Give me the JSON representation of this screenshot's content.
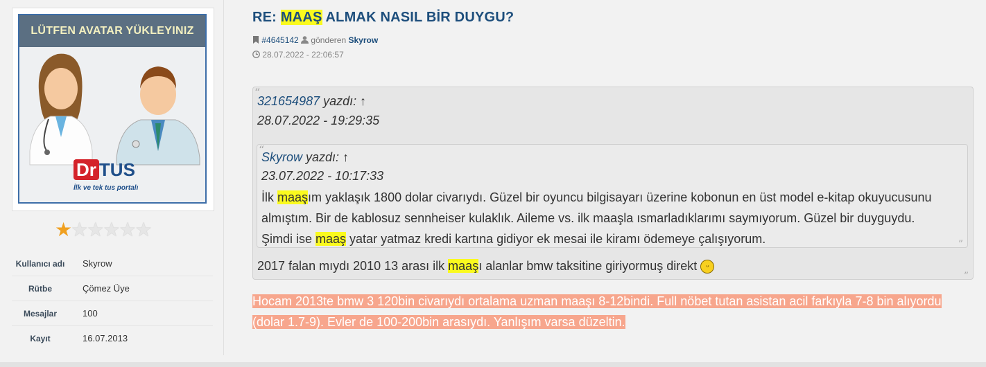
{
  "sidebar": {
    "avatar": {
      "banner": "LÜTFEN AVATAR YÜKLEYINIZ",
      "logo_dr": "Dr",
      "logo_tus": "TUS",
      "tagline": "İlk ve tek tus portalı"
    },
    "rating": {
      "filled": 1,
      "total": 6
    },
    "info": [
      {
        "label": "Kullanıcı adı",
        "value": "Skyrow"
      },
      {
        "label": "Rütbe",
        "value": "Çömez Üye"
      },
      {
        "label": "Mesajlar",
        "value": "100"
      },
      {
        "label": "Kayıt",
        "value": "16.07.2013"
      }
    ]
  },
  "post": {
    "title_prefix": "RE: ",
    "title_highlight": "MAAŞ",
    "title_suffix": " ALMAK NASIL BİR DUYGU?",
    "post_id": "#4645142",
    "sent_by_label": "gönderen",
    "author": "Skyrow",
    "datetime": "28.07.2022 - 22:06:57"
  },
  "quote": {
    "author": "321654987",
    "wrote_label": "yazdı:",
    "arrow": "↑",
    "date": "28.07.2022 - 19:29:35",
    "nested": {
      "author": "Skyrow",
      "wrote_label": "yazdı:",
      "arrow": "↑",
      "date": "23.07.2022 - 10:17:33",
      "text_p1a": "İlk ",
      "text_p1hl": "maaş",
      "text_p1b": "ım yaklaşık 1800 dolar civarıydı. Güzel bir oyuncu bilgisayarı üzerine kobonun en üst model e-kitap okuyucusunu almıştım. Bir de kablosuz sennheiser kulaklık. Aileme vs. ilk maaşla ısmarladıklarımı saymıyorum. Güzel bir duyguydu. Şimdi ise ",
      "text_p2hl": "maaş",
      "text_p2b": " yatar yatmaz kredi kartına gidiyor ek mesai ile kiramı ödemeye çalışıyorum."
    },
    "text_a": "2017 falan mıydı 2010 13 arası ilk ",
    "text_hl": "maaş",
    "text_b": "ı alanlar bmw taksitine giriyormuş direkt",
    "smiley": "😄"
  },
  "reply": {
    "text": "Hocam 2013te bmw 3 120bin civarıydı ortalama uzman maaşı 8-12bindi. Full nöbet tutan asistan acil farkıyla 7-8 bin alıyordu (dolar 1.7-9). Evler de 100-200bin arasıydı. Yanlışım varsa düzeltin."
  },
  "icons": {
    "bookmark": "bookmark-icon",
    "user": "user-icon",
    "clock": "clock-icon"
  },
  "colors": {
    "title": "#1d4e7c",
    "highlight": "#fafa1e",
    "reply_bg": "#f7a68d",
    "star": "#f0a020"
  }
}
